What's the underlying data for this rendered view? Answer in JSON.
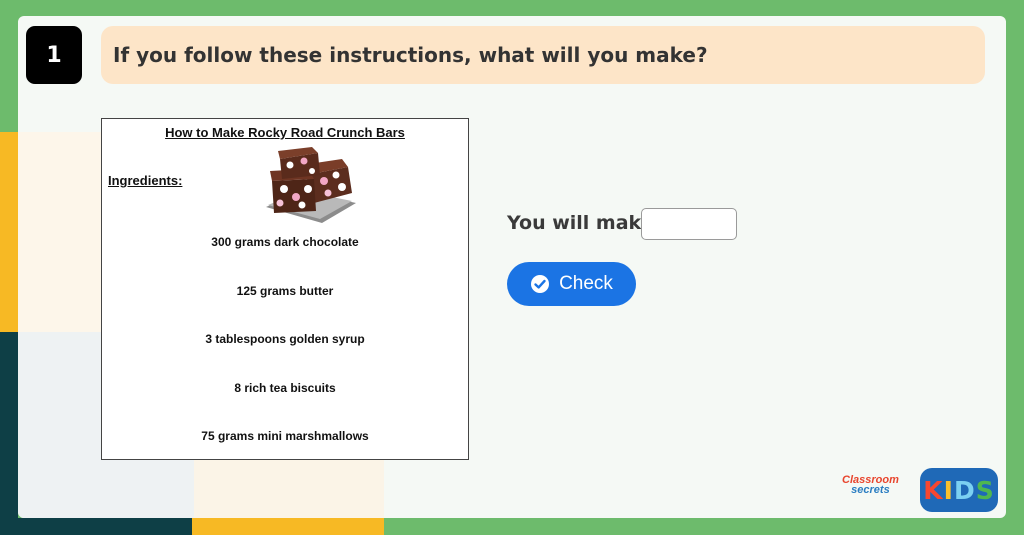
{
  "question": {
    "number": "1",
    "text": "If you follow these instructions, what will you make?"
  },
  "recipe": {
    "title": "How to Make Rocky Road Crunch Bars",
    "ingredients_label": "Ingredients:",
    "image_name": "rocky-road-bars-image",
    "ingredients": [
      "300 grams dark chocolate",
      "125 grams butter",
      "3 tablespoons golden syrup",
      "8 rich tea biscuits",
      "75 grams mini marshmallows"
    ]
  },
  "answer": {
    "label": "You will make",
    "value": "",
    "placeholder": ""
  },
  "check_button": {
    "label": "Check",
    "icon": "check-circle-icon"
  },
  "branding": {
    "classroom": "Classroom",
    "secrets": "secrets",
    "kids": [
      "K",
      "I",
      "D",
      "S"
    ]
  },
  "colors": {
    "question_bar": "#fde5c8",
    "number_badge": "#000000",
    "check_button": "#1b74e4",
    "frame_green": "#6dbb6c",
    "frame_yellow": "#f7b924",
    "frame_dark": "#0e3f46"
  }
}
